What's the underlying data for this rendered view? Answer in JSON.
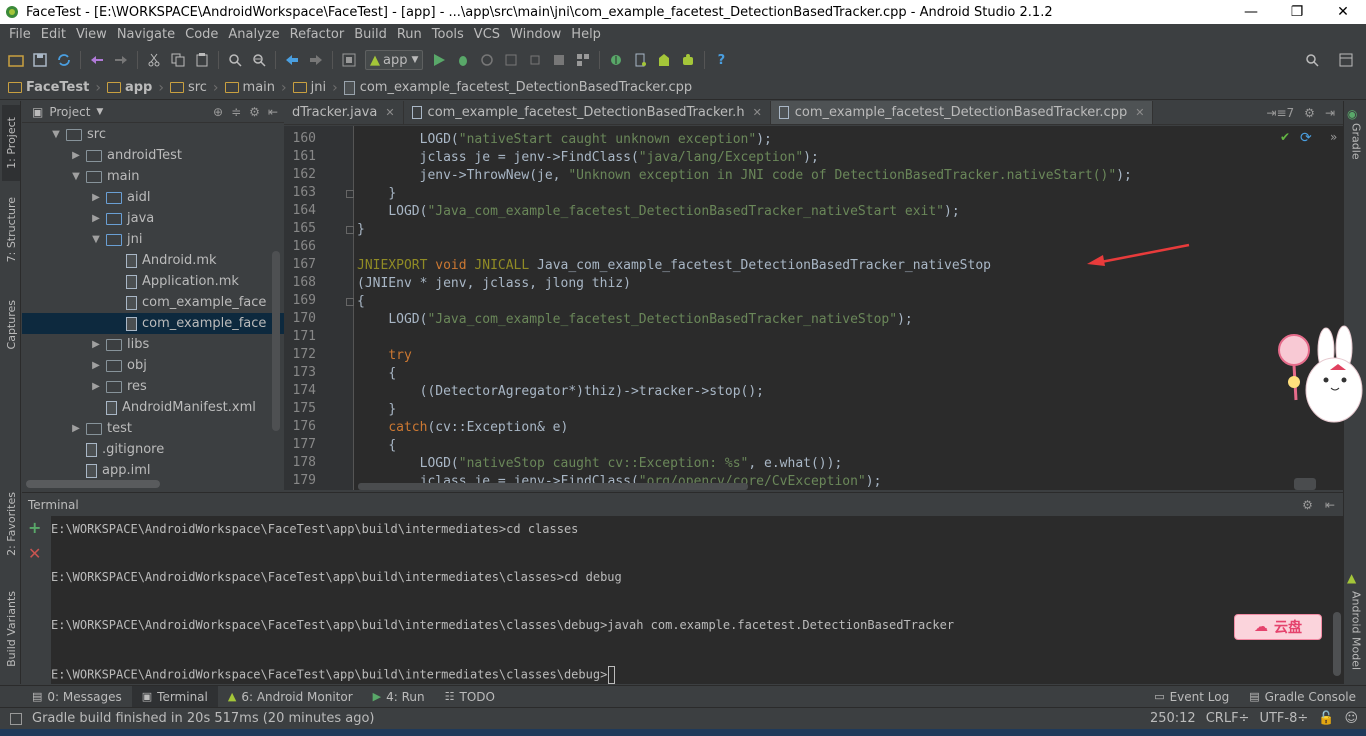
{
  "window": {
    "title": "FaceTest - [E:\\WORKSPACE\\AndroidWorkspace\\FaceTest] - [app] - ...\\app\\src\\main\\jni\\com_example_facetest_DetectionBasedTracker.cpp - Android Studio 2.1.2",
    "controls": [
      "—",
      "❐",
      "✕"
    ]
  },
  "menu": [
    "File",
    "Edit",
    "View",
    "Navigate",
    "Code",
    "Analyze",
    "Refactor",
    "Build",
    "Run",
    "Tools",
    "VCS",
    "Window",
    "Help"
  ],
  "toolbar": {
    "run_config": "app",
    "help": "?"
  },
  "breadcrumb": [
    "FaceTest",
    "app",
    "src",
    "main",
    "jni",
    "com_example_facetest_DetectionBasedTracker.cpp"
  ],
  "left_strip": [
    "1: Project",
    "7: Structure",
    "Captures",
    "2: Favorites",
    "Build Variants"
  ],
  "right_strip": [
    "Gradle",
    "Android Model"
  ],
  "project": {
    "header": "Project",
    "tree": [
      {
        "label": "src",
        "depth": 2,
        "arrow": "▼",
        "kind": "folder"
      },
      {
        "label": "androidTest",
        "depth": 3,
        "arrow": "▶",
        "kind": "folder"
      },
      {
        "label": "main",
        "depth": 3,
        "arrow": "▼",
        "kind": "folder"
      },
      {
        "label": "aidl",
        "depth": 4,
        "arrow": "▶",
        "kind": "folder-blue"
      },
      {
        "label": "java",
        "depth": 4,
        "arrow": "▶",
        "kind": "folder-blue"
      },
      {
        "label": "jni",
        "depth": 4,
        "arrow": "▼",
        "kind": "folder-blue"
      },
      {
        "label": "Android.mk",
        "depth": 5,
        "arrow": "",
        "kind": "file"
      },
      {
        "label": "Application.mk",
        "depth": 5,
        "arrow": "",
        "kind": "file"
      },
      {
        "label": "com_example_face",
        "depth": 5,
        "arrow": "",
        "kind": "file"
      },
      {
        "label": "com_example_face",
        "depth": 5,
        "arrow": "",
        "kind": "file",
        "selected": true
      },
      {
        "label": "libs",
        "depth": 4,
        "arrow": "▶",
        "kind": "folder"
      },
      {
        "label": "obj",
        "depth": 4,
        "arrow": "▶",
        "kind": "folder"
      },
      {
        "label": "res",
        "depth": 4,
        "arrow": "▶",
        "kind": "folder"
      },
      {
        "label": "AndroidManifest.xml",
        "depth": 4,
        "arrow": "",
        "kind": "file"
      },
      {
        "label": "test",
        "depth": 3,
        "arrow": "▶",
        "kind": "folder"
      },
      {
        "label": ".gitignore",
        "depth": 3,
        "arrow": "",
        "kind": "file"
      },
      {
        "label": "app.iml",
        "depth": 3,
        "arrow": "",
        "kind": "file"
      }
    ]
  },
  "editor_tabs": [
    {
      "label": "dTracker.java",
      "active": false
    },
    {
      "label": "com_example_facetest_DetectionBasedTracker.h",
      "active": false
    },
    {
      "label": "com_example_facetest_DetectionBasedTracker.cpp",
      "active": true
    }
  ],
  "editor": {
    "lines": [
      {
        "n": "160",
        "ind": 8,
        "parts": [
          [
            "fn",
            "LOGD("
          ],
          [
            "str",
            "\"nativeStart caught unknown exception\""
          ],
          [
            "fn",
            ");"
          ]
        ]
      },
      {
        "n": "161",
        "ind": 8,
        "parts": [
          [
            "fn",
            "jclass je = jenv->FindClass("
          ],
          [
            "str",
            "\"java/lang/Exception\""
          ],
          [
            "fn",
            ");"
          ]
        ]
      },
      {
        "n": "162",
        "ind": 8,
        "parts": [
          [
            "fn",
            "jenv->ThrowNew(je, "
          ],
          [
            "str",
            "\"Unknown exception in JNI code of DetectionBasedTracker.nativeStart()\""
          ],
          [
            "fn",
            ");"
          ]
        ]
      },
      {
        "n": "163",
        "ind": 4,
        "parts": [
          [
            "fn",
            "}"
          ]
        ]
      },
      {
        "n": "164",
        "ind": 4,
        "parts": [
          [
            "fn",
            "LOGD("
          ],
          [
            "str",
            "\"Java_com_example_facetest_DetectionBasedTracker_nativeStart exit\""
          ],
          [
            "fn",
            ");"
          ]
        ]
      },
      {
        "n": "165",
        "ind": 0,
        "parts": [
          [
            "fn",
            "}"
          ]
        ]
      },
      {
        "n": "166",
        "ind": 0,
        "parts": []
      },
      {
        "n": "167",
        "ind": 0,
        "parts": [
          [
            "mac",
            "JNIEXPORT "
          ],
          [
            "kw",
            "void "
          ],
          [
            "mac",
            "JNICALL "
          ],
          [
            "fn",
            "Java_com_example_facetest_DetectionBasedTracker_nativeStop"
          ]
        ]
      },
      {
        "n": "168",
        "ind": 0,
        "parts": [
          [
            "fn",
            "(JNIEnv * jenv, jclass, jlong thiz)"
          ]
        ]
      },
      {
        "n": "169",
        "ind": 0,
        "parts": [
          [
            "fn",
            "{"
          ]
        ]
      },
      {
        "n": "170",
        "ind": 4,
        "parts": [
          [
            "fn",
            "LOGD("
          ],
          [
            "str",
            "\"Java_com_example_facetest_DetectionBasedTracker_nativeStop\""
          ],
          [
            "fn",
            ");"
          ]
        ]
      },
      {
        "n": "171",
        "ind": 0,
        "parts": []
      },
      {
        "n": "172",
        "ind": 4,
        "parts": [
          [
            "kw",
            "try"
          ]
        ]
      },
      {
        "n": "173",
        "ind": 4,
        "parts": [
          [
            "fn",
            "{"
          ]
        ]
      },
      {
        "n": "174",
        "ind": 8,
        "parts": [
          [
            "fn",
            "((DetectorAgregator*)thiz)->tracker->stop();"
          ]
        ]
      },
      {
        "n": "175",
        "ind": 4,
        "parts": [
          [
            "fn",
            "}"
          ]
        ]
      },
      {
        "n": "176",
        "ind": 4,
        "parts": [
          [
            "kw",
            "catch"
          ],
          [
            "fn",
            "(cv::Exception& e)"
          ]
        ]
      },
      {
        "n": "177",
        "ind": 4,
        "parts": [
          [
            "fn",
            "{"
          ]
        ]
      },
      {
        "n": "178",
        "ind": 8,
        "parts": [
          [
            "fn",
            "LOGD("
          ],
          [
            "str",
            "\"nativeStop caught cv::Exception: %s\""
          ],
          [
            "fn",
            ", e.what());"
          ]
        ]
      },
      {
        "n": "179",
        "ind": 8,
        "parts": [
          [
            "fn",
            "jclass je = jenv->FindClass("
          ],
          [
            "str",
            "\"org/opencv/core/CvException\""
          ],
          [
            "fn",
            ");"
          ]
        ]
      }
    ]
  },
  "terminal": {
    "title": "Terminal",
    "lines": [
      "E:\\WORKSPACE\\AndroidWorkspace\\FaceTest\\app\\build\\intermediates>cd classes",
      "",
      "E:\\WORKSPACE\\AndroidWorkspace\\FaceTest\\app\\build\\intermediates\\classes>cd debug",
      "",
      "E:\\WORKSPACE\\AndroidWorkspace\\FaceTest\\app\\build\\intermediates\\classes\\debug>javah com.example.facetest.DetectionBasedTracker",
      "",
      "E:\\WORKSPACE\\AndroidWorkspace\\FaceTest\\app\\build\\intermediates\\classes\\debug>"
    ]
  },
  "bottom_tabs": {
    "left": [
      {
        "label": "0: Messages",
        "icon": "messages-icon"
      },
      {
        "label": "Terminal",
        "icon": "terminal-icon",
        "active": true
      },
      {
        "label": "6: Android Monitor",
        "icon": "android-icon"
      },
      {
        "label": "4: Run",
        "icon": "run-icon"
      },
      {
        "label": "TODO",
        "icon": "todo-icon"
      }
    ],
    "right": [
      {
        "label": "Event Log",
        "icon": "event-log-icon"
      },
      {
        "label": "Gradle Console",
        "icon": "gradle-console-icon"
      }
    ]
  },
  "status": {
    "message": "Gradle build finished in 20s 517ms (20 minutes ago)",
    "position": "250:12",
    "line_sep": "CRLF÷",
    "encoding": "UTF-8÷"
  },
  "badge": {
    "text": "云盘"
  },
  "colors": {
    "accent_green": "#62b543",
    "error_red": "#c75450",
    "arrow_red": "#e83b3b"
  }
}
